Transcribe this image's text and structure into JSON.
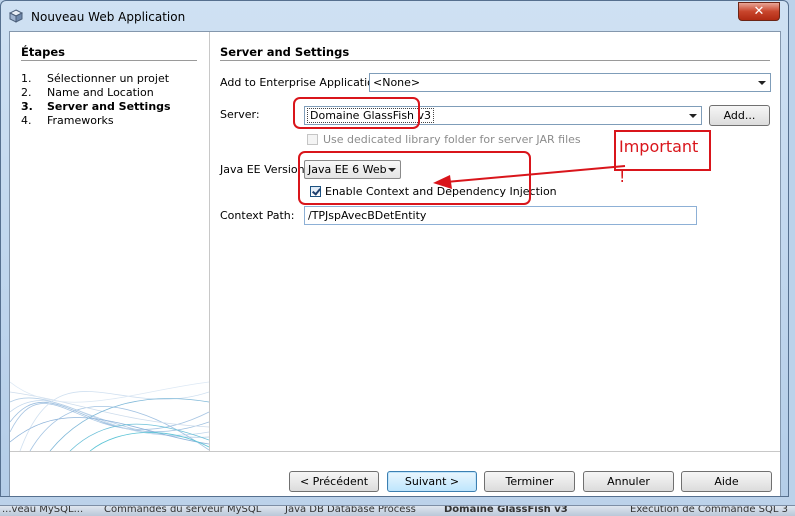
{
  "window": {
    "title": "Nouveau Web Application",
    "close_label": "✕"
  },
  "steps": {
    "title": "Étapes",
    "items": [
      {
        "num": "1.",
        "label": "Sélectionner un projet",
        "current": false
      },
      {
        "num": "2.",
        "label": "Name and Location",
        "current": false
      },
      {
        "num": "3.",
        "label": "Server and Settings",
        "current": true
      },
      {
        "num": "4.",
        "label": "Frameworks",
        "current": false
      }
    ]
  },
  "panel": {
    "title": "Server and Settings",
    "enterprise_label": "Add to Enterprise Application:",
    "enterprise_value": "<None>",
    "server_label": "Server:",
    "server_value": "Domaine GlassFish v3",
    "add_button": "Add...",
    "library_checkbox_label": "Use dedicated library folder for server JAR files",
    "library_checked": false,
    "javaee_label": "Java EE Version:",
    "javaee_value": "Java EE 6 Web",
    "cdi_checkbox_label": "Enable Context and Dependency Injection",
    "cdi_checked": true,
    "context_label": "Context Path:",
    "context_value": "/TPJspAvecBDetEntity"
  },
  "annotation": {
    "text": "Important !",
    "color": "#d9151b"
  },
  "buttons": {
    "back": "< Précédent",
    "next": "Suivant >",
    "finish": "Terminer",
    "cancel": "Annuler",
    "help": "Aide"
  },
  "taskbar": {
    "items": [
      {
        "label": "...veau MySQL...",
        "active": false
      },
      {
        "label": "Commandes du serveur MySQL",
        "active": false
      },
      {
        "label": "Java DB Database Process",
        "active": false
      },
      {
        "label": "Domaine GlassFish v3",
        "active": true
      },
      {
        "label": "Exécution de Commande SQL 3",
        "active": false
      }
    ]
  }
}
